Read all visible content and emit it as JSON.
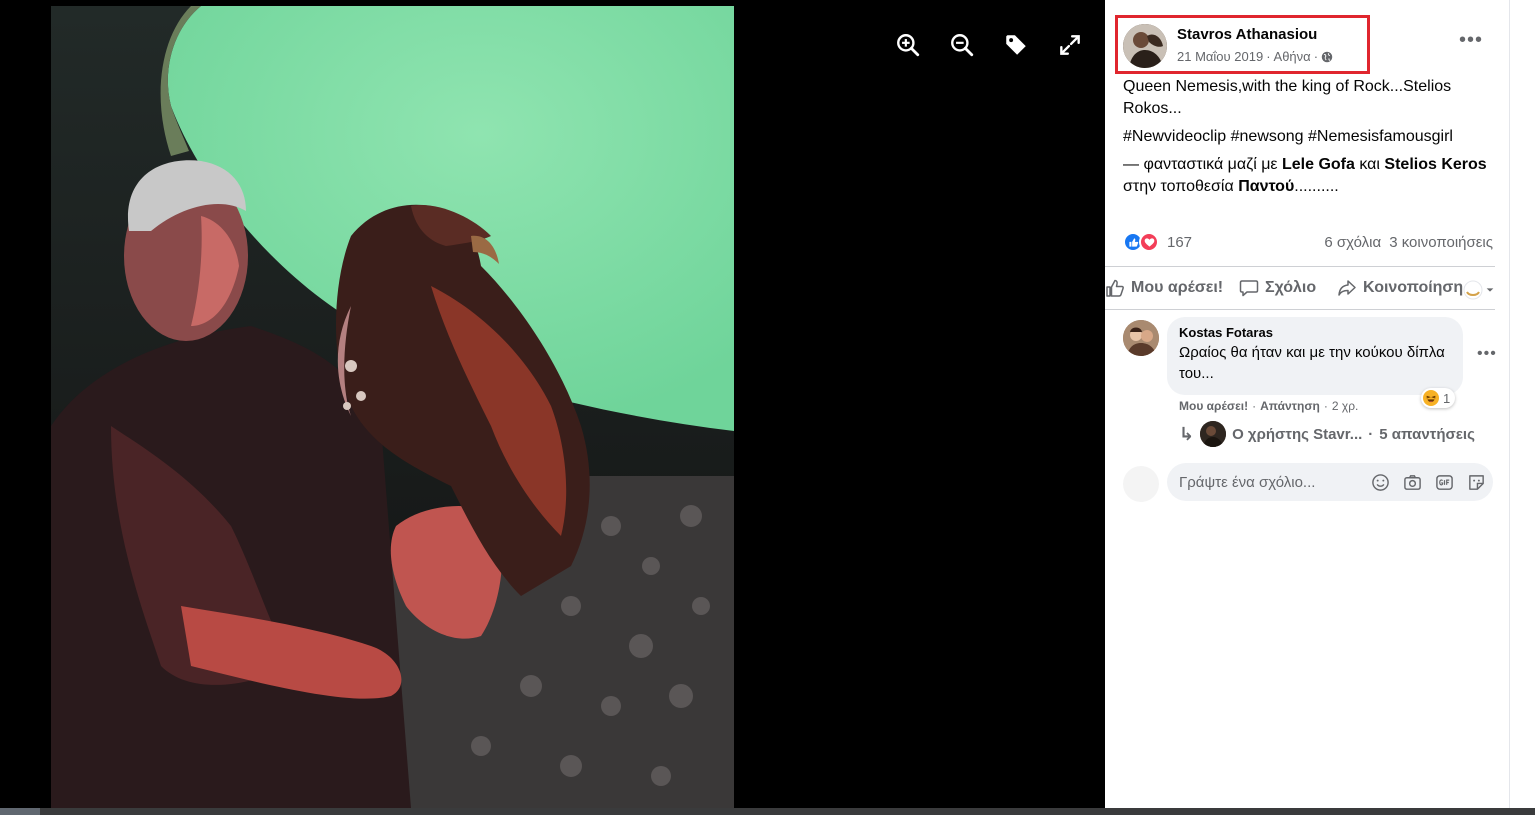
{
  "post": {
    "author": "Stavros Athanasiou",
    "date": "21 Μαΐου 2019",
    "separator": "·",
    "location": "Αθήνα",
    "text_line1": "Queen Nemesis,with the king of Rock...Stelios Rokos...",
    "hashtags": [
      "#Newvideoclip",
      "#newsong",
      "#Nemesisfamousgirl"
    ],
    "with_prefix": "— φανταστικά μαζί με",
    "with_person1": "Lele Gofa",
    "with_and": "και",
    "with_person2": "Stelios Keros",
    "place_prefix": "στην τοποθεσία",
    "place": "Παντού",
    "place_suffix": "..........",
    "more_icon": "more-horizontal-icon"
  },
  "reactions": {
    "types": [
      "like",
      "love"
    ],
    "count": "167",
    "comments": "6 σχόλια",
    "shares": "3 κοινοποιήσεις"
  },
  "actions": {
    "like": "Μου αρέσει!",
    "comment": "Σχόλιο",
    "share": "Κοινοποίηση"
  },
  "comment": {
    "author": "Kostas Fotaras",
    "text": "Ωραίος θα ήταν και με την κούκου δίπλα του...",
    "reaction_count": "1",
    "like_label": "Μου αρέσει!",
    "dot": "·",
    "reply_label": "Απάντηση",
    "time": "2 χρ.",
    "replies_author": "Ο χρήστης Stavr...",
    "replies_count": "5 απαντήσεις"
  },
  "composer": {
    "placeholder": "Γράψτε ένα σχόλιο..."
  },
  "viewer": {
    "tools": [
      "zoom-in-icon",
      "zoom-out-icon",
      "tag-icon",
      "fullscreen-icon"
    ]
  },
  "colors": {
    "highlight_box": "#e0262e",
    "like_blue": "#1877f2",
    "love_red": "#f33e58",
    "secondary_text": "#65676b"
  }
}
